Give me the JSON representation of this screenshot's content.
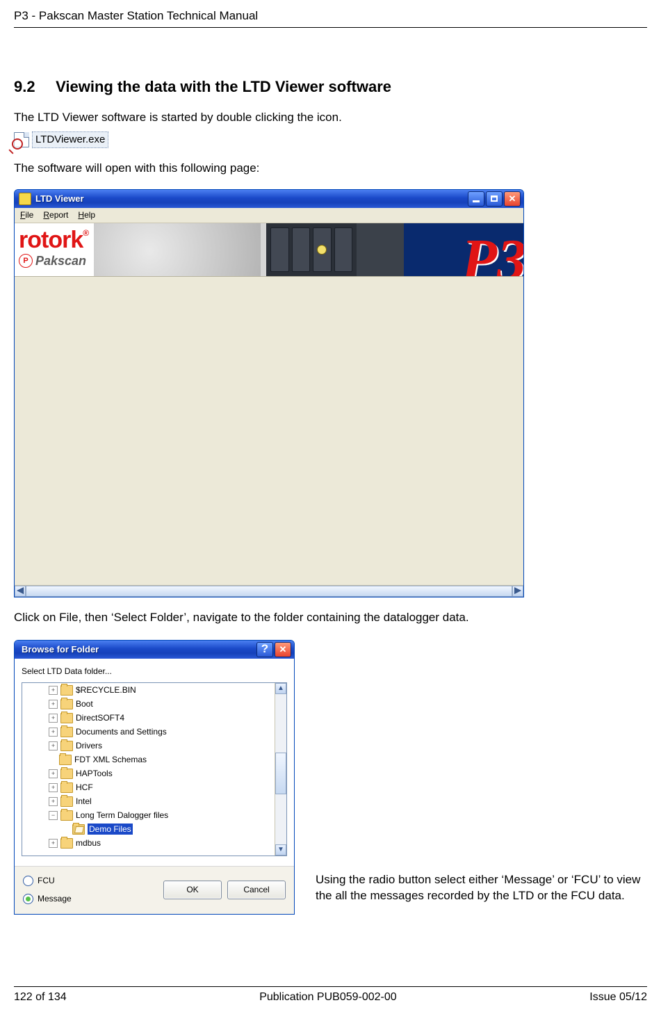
{
  "doc": {
    "header": "P3 - Pakscan Master Station Technical Manual",
    "section_number": "9.2",
    "section_title": "Viewing the data with the LTD Viewer software",
    "para1": "The LTD Viewer software is started by double clicking the icon.",
    "exe_label": "LTDViewer.exe",
    "para2": "The software will open with this following page:",
    "para3": "Click on File, then ‘Select Folder’, navigate to the folder containing the datalogger data.",
    "para4": "Using the radio button select either ‘Message’ or ‘FCU’ to view the all the messages recorded by the LTD or the FCU data.",
    "footer_left": "122 of 134",
    "footer_center": "Publication PUB059-002-00",
    "footer_right": "Issue 05/12"
  },
  "ltd_window": {
    "title": "LTD Viewer",
    "menu": {
      "file": "File",
      "report": "Report",
      "help": "Help"
    },
    "brand": {
      "rotork": "rotork",
      "reg": "®",
      "pakscan": "Pakscan",
      "p3": "P3"
    }
  },
  "browse_dialog": {
    "title": "Browse for Folder",
    "hint": "Select LTD Data folder...",
    "tree": {
      "items": [
        "$RECYCLE.BIN",
        "Boot",
        "DirectSOFT4",
        "Documents and Settings",
        "Drivers",
        "FDT XML Schemas",
        "HAPTools",
        "HCF",
        "Intel",
        "Long Term Dalogger files",
        "Demo Files",
        "mdbus"
      ]
    },
    "radios": {
      "fcu": "FCU",
      "message": "Message"
    },
    "buttons": {
      "ok": "OK",
      "cancel": "Cancel"
    }
  }
}
